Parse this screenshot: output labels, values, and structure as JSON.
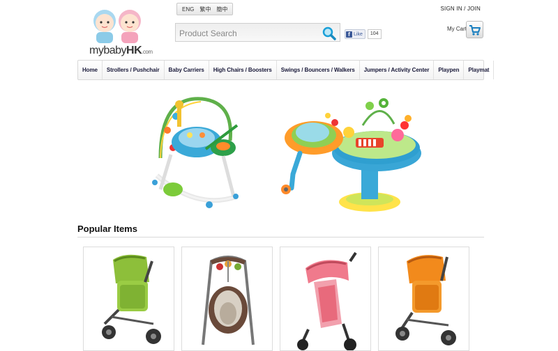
{
  "header": {
    "logo_text_main": "mybaby",
    "logo_text_bold": "HK",
    "logo_text_suffix": ".com",
    "languages": [
      "ENG",
      "繁中",
      "簡中"
    ],
    "search_placeholder": "Product Search",
    "fb_like_label": "Like",
    "fb_like_count": "104",
    "signin_label": "SIGN IN / JOIN",
    "cart_label": "My Cart"
  },
  "nav": {
    "items": [
      "Home",
      "Strollers / Pushchair",
      "Baby Carriers",
      "High Chairs / Boosters",
      "Swings / Bouncers / Walkers",
      "Jumpers / Activity Center",
      "Playpen",
      "Playmat"
    ]
  },
  "popular": {
    "title": "Popular Items",
    "products": [
      {
        "icon": "green-stroller-image",
        "color": "#8dbf3a"
      },
      {
        "icon": "baby-swing-image",
        "color": "#6a4a3a"
      },
      {
        "icon": "pink-stroller-image",
        "color": "#f07a8c"
      },
      {
        "icon": "orange-stroller-image",
        "color": "#f28a1c"
      }
    ]
  },
  "colors": {
    "nav_text": "#1a1a3a",
    "border": "#d8d8d8"
  }
}
